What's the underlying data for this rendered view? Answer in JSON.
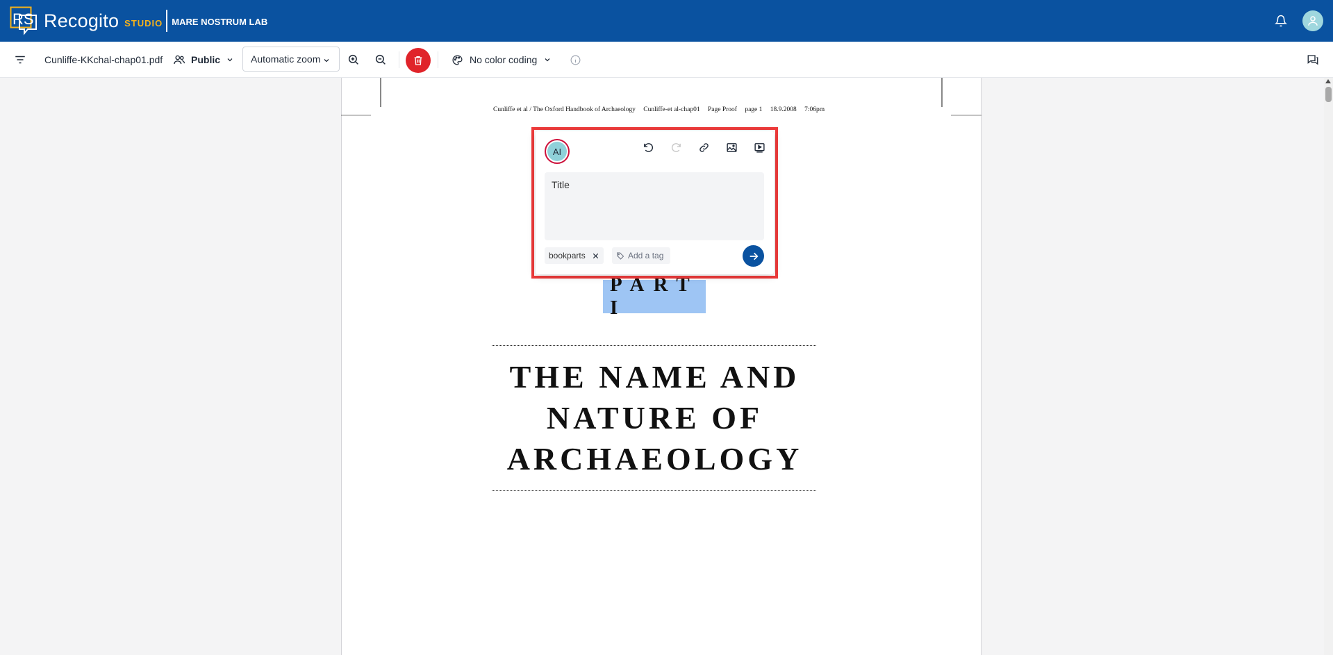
{
  "header": {
    "brand": "Recogito",
    "brand_suffix": "STUDIO",
    "org": "MARE NOSTRUM LAB",
    "colors": {
      "bar": "#0a52a0",
      "accent": "#f5b21a"
    }
  },
  "toolbar": {
    "filename": "Cunliffe-KKchal-chap01.pdf",
    "visibility": "Public",
    "zoom": "Automatic zoom",
    "color_coding": "No color coding"
  },
  "document": {
    "running_head": {
      "authors": "Cunliffe et al / The Oxford Handbook of Archaeology",
      "file": "Cunliffe-et al-chap01",
      "status": "Page Proof",
      "page": "page 1",
      "date": "18.9.2008",
      "time": "7:06pm"
    },
    "part": "PART I",
    "chapter_title_lines": [
      "THE NAME AND",
      "NATURE OF",
      "ARCHAEOLOGY"
    ]
  },
  "popup": {
    "avatar_initials": "AI",
    "editor_text": "Title",
    "tags": [
      "bookparts"
    ],
    "tag_placeholder": "Add a tag"
  }
}
